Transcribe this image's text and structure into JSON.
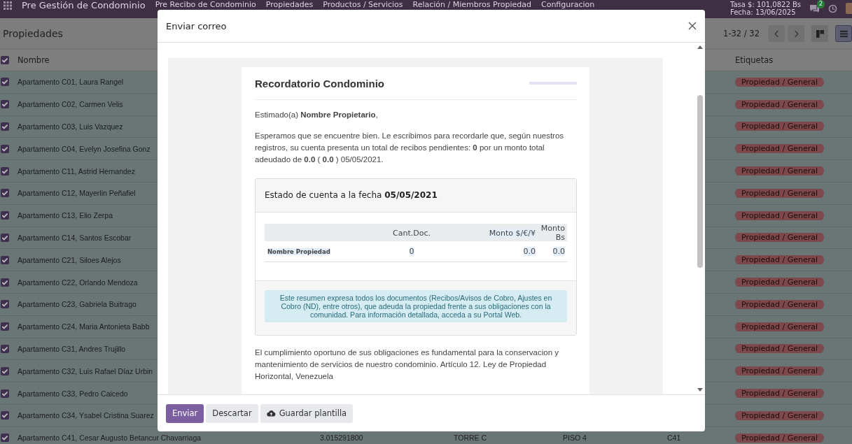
{
  "navbar": {
    "app_title": "Pre Gestión de Condominio",
    "menu": [
      "Pre Recibo de Condominio",
      "Propiedades",
      "Productos / Servicios",
      "Relación / Miembros Propiedad",
      "Configuracion"
    ],
    "rate": "Tasa $: 101,0822 Bs",
    "date": "Fecha: 13/06/2025",
    "chat_badge": "2"
  },
  "control_panel": {
    "title": "Propiedades",
    "pager": "1-32 / 32",
    "views": [
      {
        "kind": "kanban",
        "selected": false
      },
      {
        "kind": "list",
        "selected": true
      }
    ]
  },
  "table": {
    "select_all_checked": true,
    "columns": [
      "Nombre",
      "Etiquetas"
    ],
    "rows": [
      {
        "name": "Apartamento C01, Laura Rangel",
        "checked": true,
        "tags": [
          "Propiedad / General"
        ]
      },
      {
        "name": "Apartamento C02, Carmen Velis",
        "checked": true,
        "tags": [
          "Propiedad / General"
        ]
      },
      {
        "name": "Apartamento C03, Luis Vazquez",
        "checked": true,
        "tags": [
          "Propiedad / General"
        ]
      },
      {
        "name": "Apartamento C04, Evelyn Josefina Gonz",
        "checked": true,
        "tags": [
          "Propiedad / General"
        ]
      },
      {
        "name": "Apartamento C11, Astrid Hernandez",
        "checked": true,
        "tags": [
          "Propiedad / General"
        ]
      },
      {
        "name": "Apartamento C12, Mayerlin Peñafiel",
        "checked": true,
        "tags": [
          "Propiedad / General"
        ]
      },
      {
        "name": "Apartamento C13, Elio Zerpa",
        "checked": true,
        "tags": [
          "Propiedad / General"
        ]
      },
      {
        "name": "Apartamento C14, Santos Escobar",
        "checked": true,
        "tags": [
          "Propiedad / General"
        ]
      },
      {
        "name": "Apartamento C21, Siloes Alejos",
        "checked": true,
        "tags": [
          "Propiedad / General"
        ]
      },
      {
        "name": "Apartamento C22, Orlando Mendoza",
        "checked": true,
        "tags": [
          "Propiedad / General"
        ]
      },
      {
        "name": "Apartamento C23, Gabriela Buitrago",
        "checked": true,
        "tags": [
          "Propiedad / General"
        ]
      },
      {
        "name": "Apartamento C24, Maria Antonieta Babb",
        "checked": true,
        "tags": [
          "Propiedad / General"
        ]
      },
      {
        "name": "Apartamento C31, Andres Trujillo",
        "checked": true,
        "tags": [
          "Propiedad / General"
        ]
      },
      {
        "name": "Apartamento C32, Luis Rafael Díaz Urbin",
        "checked": true,
        "tags": [
          "Propiedad / General"
        ]
      },
      {
        "name": "Apartamento C33, Pedro Caicedo",
        "checked": true,
        "tags": [
          "Propiedad / General"
        ]
      },
      {
        "name": "Apartamento C34, Ysabel Cristina Suarez",
        "checked": true,
        "tags": [
          "Propiedad / General"
        ]
      },
      {
        "name": "Apartamento C41, Cesar Augusto Betancur Chavarriaga",
        "checked": true,
        "column_3": "3.015291800",
        "column_4": "TORRE C",
        "column_5": "PISO 4",
        "column_6": "C41",
        "tags": [
          "Propiedad / General"
        ]
      }
    ]
  },
  "dialog": {
    "title": "Enviar correo",
    "email": {
      "title": "Recordatorio Condominio",
      "greeting": "Estimado(a) **Nombre Propietario**,",
      "intro": "Esperamos que se encuentre bien. Le escribimos para recordarle que, según nuestros registros, su cuenta presenta un total de recibos pendientes: **0** por un monto total adeudado de **0.0** ( **0.0** ) 05/05/2021.",
      "statement": {
        "heading": "Estado de cuenta a la fecha **05/05/2021**",
        "columns": [
          "Cant.Doc.",
          "Monto $/€/¥",
          "Monto Bs"
        ],
        "rows": [
          {
            "label": "Nombre Propiedad",
            "cells": [
              "0",
              "0.0",
              "0.0"
            ]
          }
        ],
        "note": "Este resumen expresa todos los documentos (Recibos/Avisos de Cobro, Ajustes en Cobro (ND), entre otros), que adeuda la propiedad frente a sus obligaciones con la comunidad. Para información detallada, acceda a su Portal Web."
      },
      "closing": "El cumplimiento oportuno de sus obligaciones es fundamental para la conservacion y mantenimiento de servicios de nuestro condominio. Artículo 12. Ley de Propiedad Horizontal, Venezuela"
    },
    "buttons": [
      {
        "label": "Enviar",
        "kind": "primary"
      },
      {
        "label": "Descartar",
        "kind": "secondary"
      },
      {
        "label": "Guardar plantilla",
        "kind": "save"
      }
    ]
  }
}
